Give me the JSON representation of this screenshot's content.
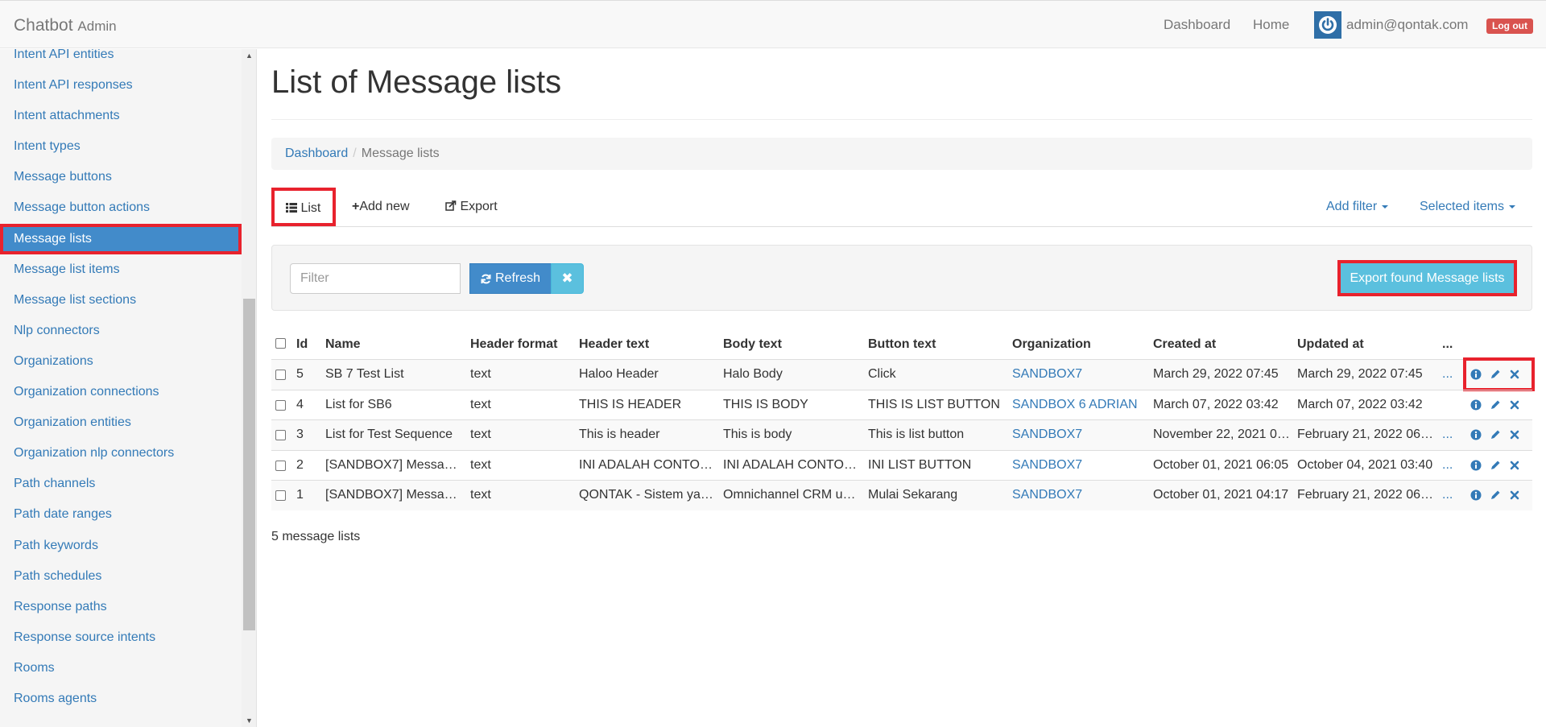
{
  "app": {
    "brand": "Chatbot",
    "brand_sub": "Admin"
  },
  "nav": {
    "dashboard": "Dashboard",
    "home": "Home",
    "user_email": "admin@qontak.com",
    "logout": "Log out"
  },
  "sidebar": {
    "items": [
      {
        "label": "Intent API entities"
      },
      {
        "label": "Intent API responses"
      },
      {
        "label": "Intent attachments"
      },
      {
        "label": "Intent types"
      },
      {
        "label": "Message buttons"
      },
      {
        "label": "Message button actions"
      },
      {
        "label": "Message lists",
        "active": true
      },
      {
        "label": "Message list items"
      },
      {
        "label": "Message list sections"
      },
      {
        "label": "Nlp connectors"
      },
      {
        "label": "Organizations"
      },
      {
        "label": "Organization connections"
      },
      {
        "label": "Organization entities"
      },
      {
        "label": "Organization nlp connectors"
      },
      {
        "label": "Path channels"
      },
      {
        "label": "Path date ranges"
      },
      {
        "label": "Path keywords"
      },
      {
        "label": "Path schedules"
      },
      {
        "label": "Response paths"
      },
      {
        "label": "Response source intents"
      },
      {
        "label": "Rooms"
      },
      {
        "label": "Rooms agents"
      }
    ]
  },
  "page": {
    "title": "List of Message lists"
  },
  "breadcrumb": {
    "home": "Dashboard",
    "current": "Message lists"
  },
  "tabs": {
    "list": "List",
    "add_new": "Add new",
    "export": "Export",
    "add_filter": "Add filter",
    "selected_items": "Selected items"
  },
  "filter": {
    "placeholder": "Filter",
    "refresh": "Refresh",
    "export_found": "Export found Message lists"
  },
  "table": {
    "columns": {
      "id": "Id",
      "name": "Name",
      "header_format": "Header format",
      "header_text": "Header text",
      "body_text": "Body text",
      "button_text": "Button text",
      "organization": "Organization",
      "created_at": "Created at",
      "updated_at": "Updated at",
      "more": "..."
    },
    "rows": [
      {
        "id": "5",
        "name": "SB 7 Test List",
        "header_format": "text",
        "header_text": "Haloo Header",
        "body_text": "Halo Body",
        "button_text": "Click",
        "organization": "SANDBOX7",
        "created_at": "March 29, 2022 07:45",
        "updated_at": "March 29, 2022 07:45",
        "more": "..."
      },
      {
        "id": "4",
        "name": "List for SB6",
        "header_format": "text",
        "header_text": "THIS IS HEADER",
        "body_text": "THIS IS BODY",
        "button_text": "THIS IS LIST BUTTON",
        "organization": "SANDBOX 6 ADRIAN",
        "created_at": "March 07, 2022 03:42",
        "updated_at": "March 07, 2022 03:42",
        "more": ""
      },
      {
        "id": "3",
        "name": "List for Test Sequence",
        "header_format": "text",
        "header_text": "This is header",
        "body_text": "This is body",
        "button_text": "This is list button",
        "organization": "SANDBOX7",
        "created_at": "November 22, 2021 0…",
        "updated_at": "February 21, 2022 06…",
        "more": "..."
      },
      {
        "id": "2",
        "name": "[SANDBOX7] Messa…",
        "header_format": "text",
        "header_text": "INI ADALAH CONTO…",
        "body_text": "INI ADALAH CONTO…",
        "button_text": "INI LIST BUTTON",
        "organization": "SANDBOX7",
        "created_at": "October 01, 2021 06:05",
        "updated_at": "October 04, 2021 03:40",
        "more": "..."
      },
      {
        "id": "1",
        "name": "[SANDBOX7] Messa…",
        "header_format": "text",
        "header_text": "QONTAK - Sistem ya…",
        "body_text": "Omnichannel CRM u…",
        "button_text": "Mulai Sekarang",
        "organization": "SANDBOX7",
        "created_at": "October 01, 2021 04:17",
        "updated_at": "February 21, 2022 06…",
        "more": "..."
      }
    ],
    "count_text": "5 message lists"
  },
  "colors": {
    "link": "#337ab7",
    "active_bg": "#428bca",
    "highlight": "#e8222d",
    "info_button": "#5bc0de",
    "danger": "#d9534f"
  },
  "icons": [
    "power-icon",
    "list-icon",
    "plus-icon",
    "share-icon",
    "caret-down-icon",
    "refresh-icon",
    "clear-icon",
    "info-icon",
    "edit-icon",
    "delete-icon"
  ]
}
